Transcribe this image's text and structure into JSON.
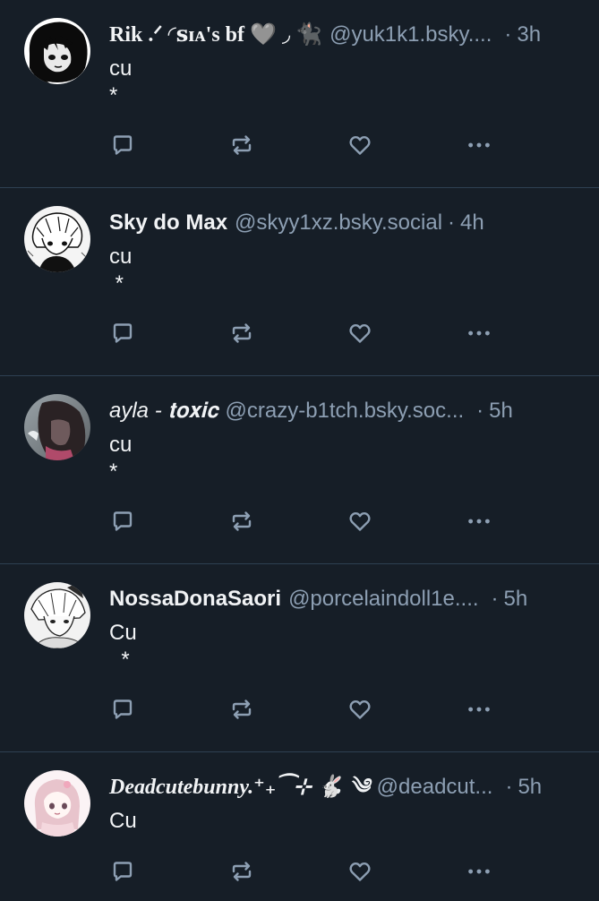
{
  "posts": [
    {
      "display_name": "Rik .ᐟ ◜ꜱɪᴀ's bf 🩶 ◞ 🐈‍⬛",
      "handle": "@yuk1k1.bsky....",
      "separator": "·",
      "time": "3h",
      "text": "cu\n*",
      "avatar": "dark-anime-avatar"
    },
    {
      "display_name": "Sky do Max",
      "handle": "@skyy1xz.bsky.social",
      "separator": "·",
      "time": "4h",
      "text": "cu\n *",
      "avatar": "manga-avatar"
    },
    {
      "display_name": "ayla - 𝐭𝐨𝐱𝐢𝐜",
      "handle": "@crazy-b1tch.bsky.soc...",
      "separator": "·",
      "time": "5h",
      "text": "cu\n*",
      "avatar": "photo-avatar"
    },
    {
      "display_name": "NossaDonaSaori",
      "handle": "@porcelaindoll1e....",
      "separator": "·",
      "time": "5h",
      "text": "Cu\n  *",
      "avatar": "sketch-avatar"
    },
    {
      "display_name": "Deadcutebunny.⁺₊⁀⊹ 🐇 ༄",
      "handle": "@deadcut...",
      "separator": "·",
      "time": "5h",
      "text": "Cu",
      "avatar": "pink-anime-avatar"
    }
  ],
  "icons": {
    "reply": "reply-icon",
    "repost": "repost-icon",
    "like": "like-icon",
    "more": "more-icon"
  },
  "colors": {
    "background": "#161e27",
    "divider": "#2e4052",
    "text": "#f1f3f5",
    "muted": "#8d9fb3"
  }
}
